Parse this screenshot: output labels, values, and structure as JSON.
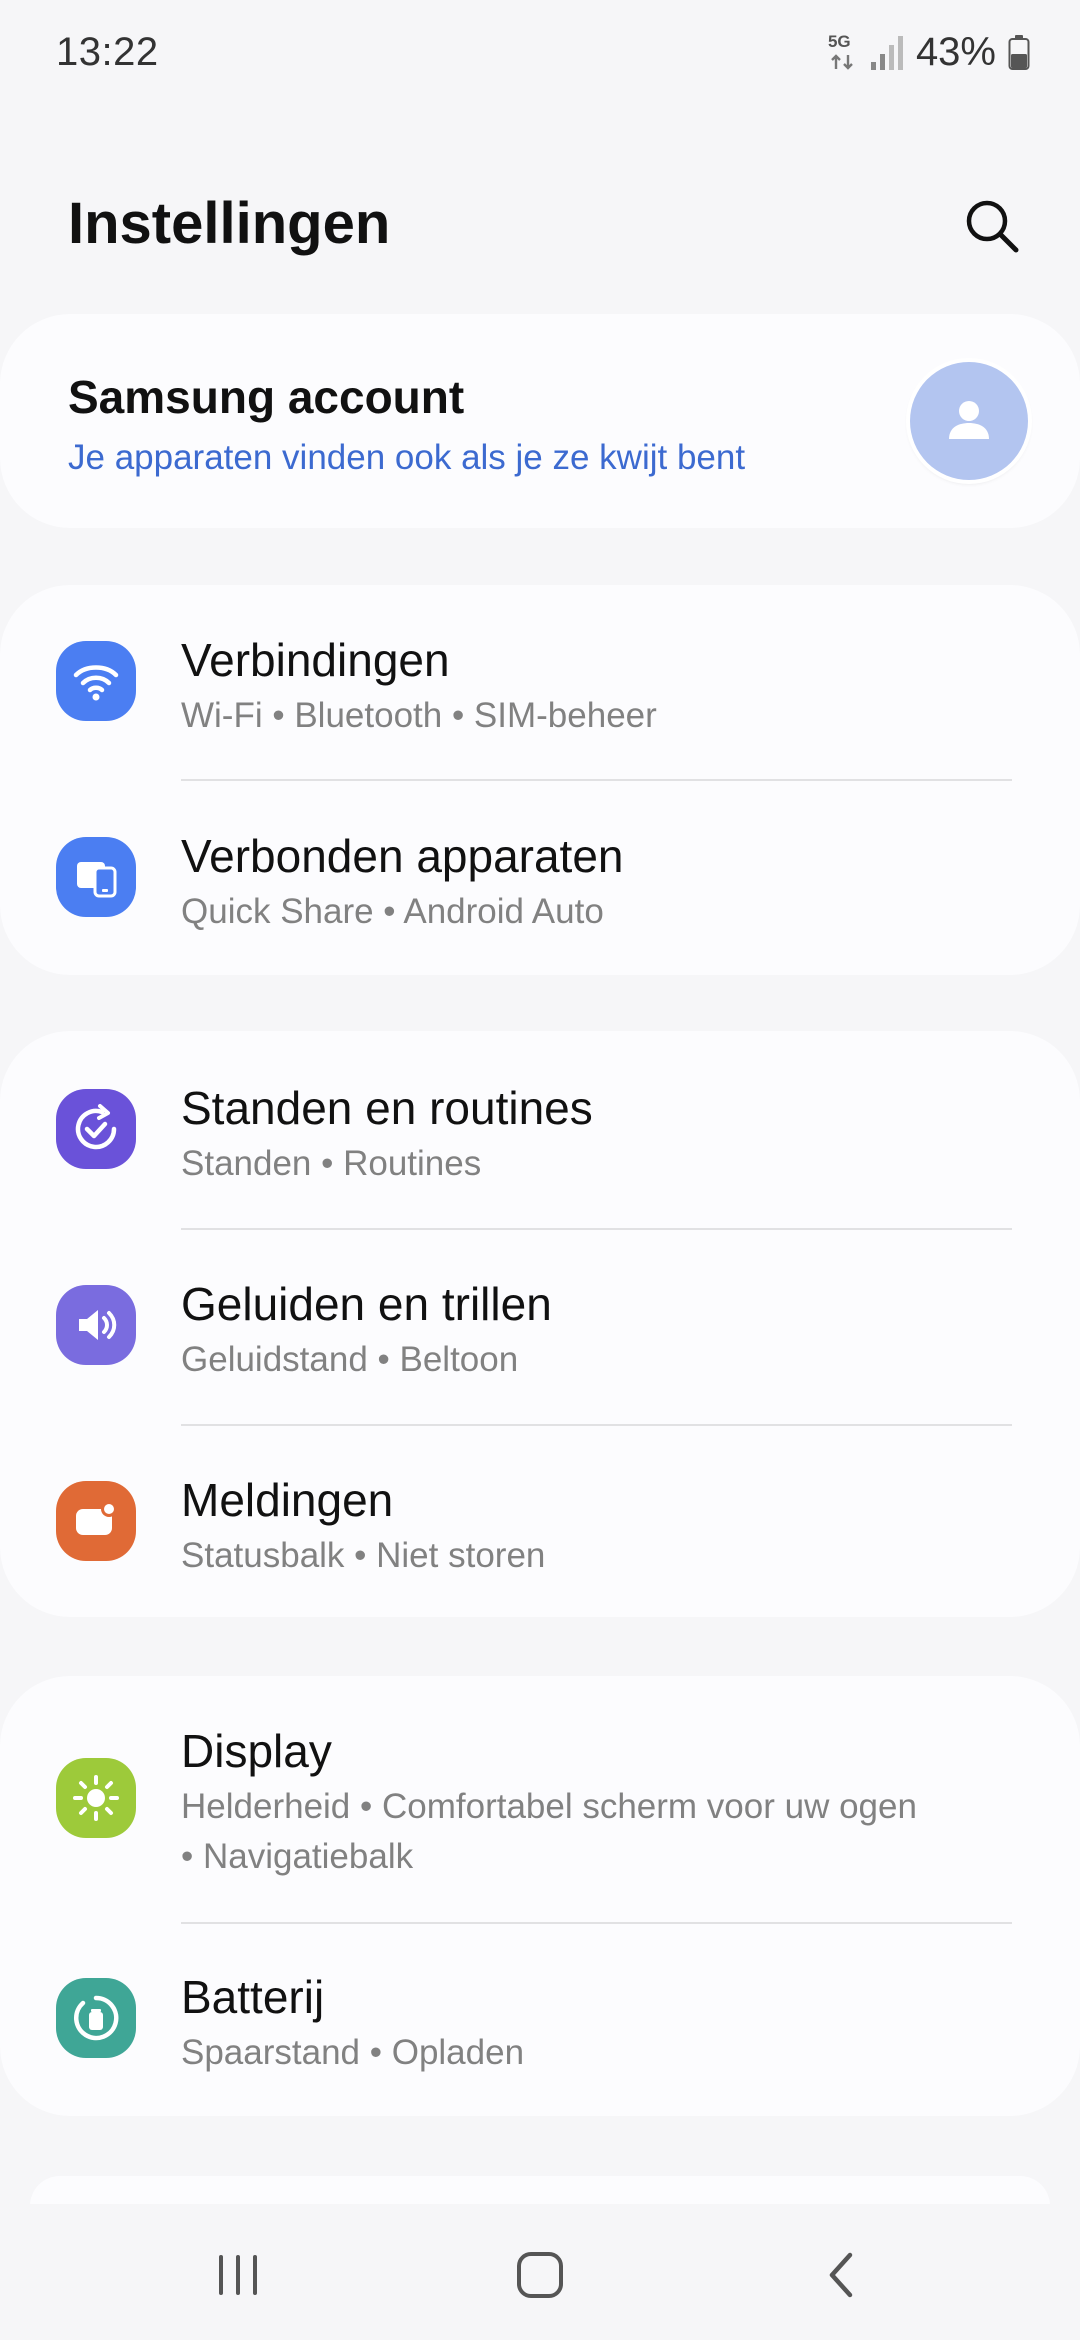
{
  "status_bar": {
    "time": "13:22",
    "network": "5G",
    "battery": "43%"
  },
  "header": {
    "title": "Instellingen",
    "search_icon": "search-icon"
  },
  "account": {
    "title": "Samsung account",
    "subtitle": "Je apparaten vinden ook als je ze kwijt bent",
    "avatar_icon": "person-icon"
  },
  "groups": [
    {
      "items": [
        {
          "title": "Verbindingen",
          "subtitle": "Wi-Fi  •  Bluetooth  •  SIM-beheer",
          "icon": "wifi-icon",
          "color": "#4b7ef2"
        },
        {
          "title": "Verbonden apparaten",
          "subtitle": "Quick Share  •  Android Auto",
          "icon": "devices-icon",
          "color": "#4b7ef2"
        }
      ]
    },
    {
      "items": [
        {
          "title": "Standen en routines",
          "subtitle": "Standen  •  Routines",
          "icon": "routines-icon",
          "color": "#6a52d9"
        },
        {
          "title": "Geluiden en trillen",
          "subtitle": "Geluidstand  •  Beltoon",
          "icon": "speaker-icon",
          "color": "#7a6cdf"
        },
        {
          "title": "Meldingen",
          "subtitle": "Statusbalk  •  Niet storen",
          "icon": "notification-icon",
          "color": "#e06a36"
        }
      ]
    },
    {
      "items": [
        {
          "title": "Display",
          "subtitle_line1": "Helderheid  •  Comfortabel scherm voor uw ogen",
          "subtitle_line2": "•  Navigatiebalk",
          "icon": "brightness-icon",
          "color": "#9dca3a"
        },
        {
          "title": "Batterij",
          "subtitle": "Spaarstand  •  Opladen",
          "icon": "battery-icon",
          "color": "#3fa696"
        }
      ]
    }
  ],
  "nav": {
    "recents_icon": "recents-icon",
    "home_icon": "home-icon",
    "back_icon": "back-icon"
  }
}
